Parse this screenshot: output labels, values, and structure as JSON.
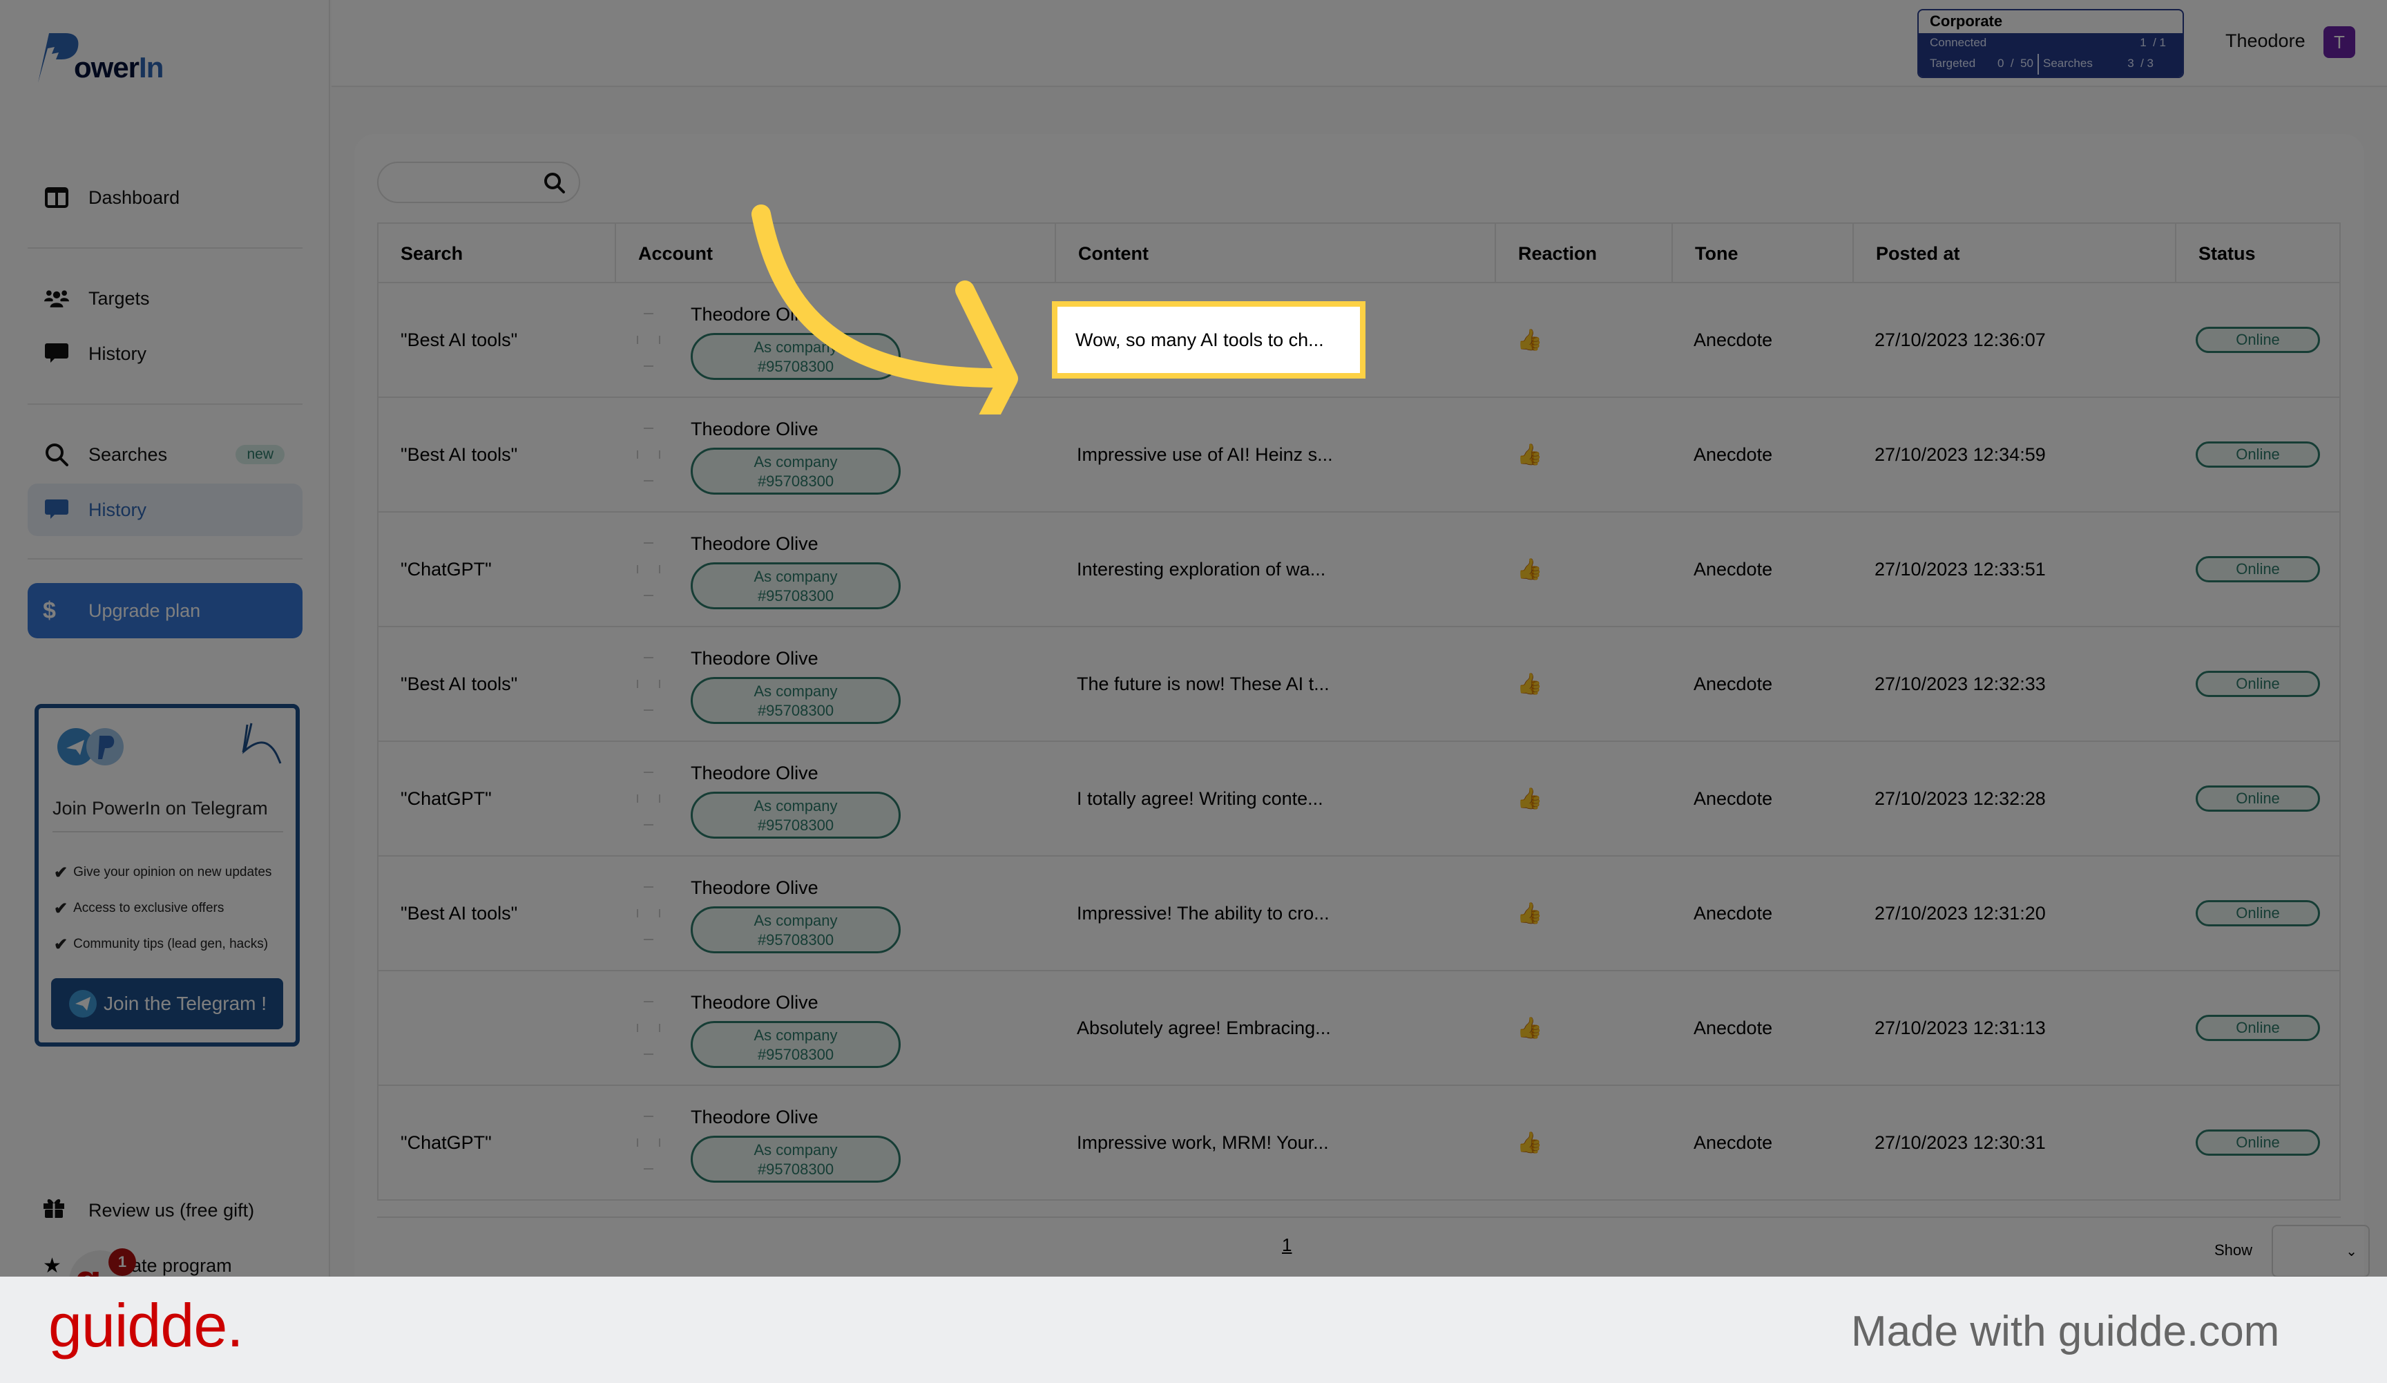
{
  "app": {
    "logo": {
      "text_main": "ower",
      "text_accent": "In",
      "brand_color": "#2f66b5"
    },
    "sidebar": {
      "items": [
        {
          "label": "Dashboard",
          "icon": "dashboard-icon"
        },
        {
          "label": "Targets",
          "icon": "users-icon"
        },
        {
          "label": "History",
          "icon": "chat-icon"
        },
        {
          "label": "Searches",
          "icon": "search-icon",
          "badge": "new"
        },
        {
          "label": "History",
          "icon": "chat-icon",
          "active": true
        }
      ],
      "upgrade": {
        "label": "Upgrade plan",
        "icon": "$"
      },
      "telegram_card": {
        "title": "Join PowerIn on Telegram",
        "benefits": [
          "Give your opinion on new updates",
          "Access to exclusive offers",
          "Community tips (lead gen, hacks)"
        ],
        "check": "✔",
        "button_label": "Join the Telegram !"
      },
      "bottom_items": [
        {
          "label": "Review us (free gift)",
          "icon": "gift-icon"
        },
        {
          "label": "Affiliate program",
          "visible_label": "ate program",
          "icon": "star-icon"
        }
      ],
      "guidde_widget": {
        "glyph": "g",
        "notification_count": "1"
      }
    },
    "topbar": {
      "plan": {
        "name": "Corporate",
        "connected_label": "Connected",
        "connected_value": "1  / 1",
        "targeted_label": "Targeted",
        "targeted_value": "0  /  50",
        "searches_label": "Searches",
        "searches_value": "3  / 3"
      },
      "user_name": "Theodore",
      "avatar_initial": "T"
    },
    "search": {
      "value": "",
      "placeholder": ""
    },
    "table": {
      "columns": [
        "Search",
        "Account",
        "Content",
        "Reaction",
        "Tone",
        "Posted at",
        "Status"
      ],
      "rows": [
        {
          "search": "\"Best AI tools\"",
          "account_name": "Theodore Olive",
          "account_badge_line1": "As company",
          "account_badge_line2": "#95708300",
          "content": "Wow, so many AI tools to ch...",
          "reaction": "👍",
          "tone": "Anecdote",
          "posted_at": "27/10/2023 12:36:07",
          "status": "Online"
        },
        {
          "search": "\"Best AI tools\"",
          "account_name": "Theodore Olive",
          "account_badge_line1": "As company",
          "account_badge_line2": "#95708300",
          "content": "Impressive use of AI! Heinz s...",
          "reaction": "👍",
          "tone": "Anecdote",
          "posted_at": "27/10/2023 12:34:59",
          "status": "Online"
        },
        {
          "search": "\"ChatGPT\"",
          "account_name": "Theodore Olive",
          "account_badge_line1": "As company",
          "account_badge_line2": "#95708300",
          "content": "Interesting exploration of wa...",
          "reaction": "👍",
          "tone": "Anecdote",
          "posted_at": "27/10/2023 12:33:51",
          "status": "Online"
        },
        {
          "search": "\"Best AI tools\"",
          "account_name": "Theodore Olive",
          "account_badge_line1": "As company",
          "account_badge_line2": "#95708300",
          "content": "The future is now! These AI t...",
          "reaction": "👍",
          "tone": "Anecdote",
          "posted_at": "27/10/2023 12:32:33",
          "status": "Online"
        },
        {
          "search": "\"ChatGPT\"",
          "account_name": "Theodore Olive",
          "account_badge_line1": "As company",
          "account_badge_line2": "#95708300",
          "content": "I totally agree! Writing conte...",
          "reaction": "👍",
          "tone": "Anecdote",
          "posted_at": "27/10/2023 12:32:28",
          "status": "Online"
        },
        {
          "search": "\"Best AI tools\"",
          "account_name": "Theodore Olive",
          "account_badge_line1": "As company",
          "account_badge_line2": "#95708300",
          "content": "Impressive! The ability to cro...",
          "reaction": "👍",
          "tone": "Anecdote",
          "posted_at": "27/10/2023 12:31:20",
          "status": "Online"
        },
        {
          "search": "",
          "account_name": "Theodore Olive",
          "account_badge_line1": "As company",
          "account_badge_line2": "#95708300",
          "content": "Absolutely agree! Embracing...",
          "reaction": "👍",
          "tone": "Anecdote",
          "posted_at": "27/10/2023 12:31:13",
          "status": "Online"
        },
        {
          "search": "\"ChatGPT\"",
          "account_name": "Theodore Olive",
          "account_badge_line1": "As company",
          "account_badge_line2": "#95708300",
          "content": "Impressive work, MRM! Your...",
          "reaction": "👍",
          "tone": "Anecdote",
          "posted_at": "27/10/2023 12:30:31",
          "status": "Online"
        }
      ]
    },
    "pagination": {
      "current_page": "1",
      "show_label": "Show",
      "show_value": "",
      "chevron": "⌄"
    }
  },
  "annotation": {
    "highlight_text": "Wow, so many AI tools to ch...",
    "highlight_color": "#fdd145"
  },
  "footer": {
    "brand": "guidde.",
    "made_with": "Made with guidde.com",
    "brand_color": "#cc0000"
  }
}
